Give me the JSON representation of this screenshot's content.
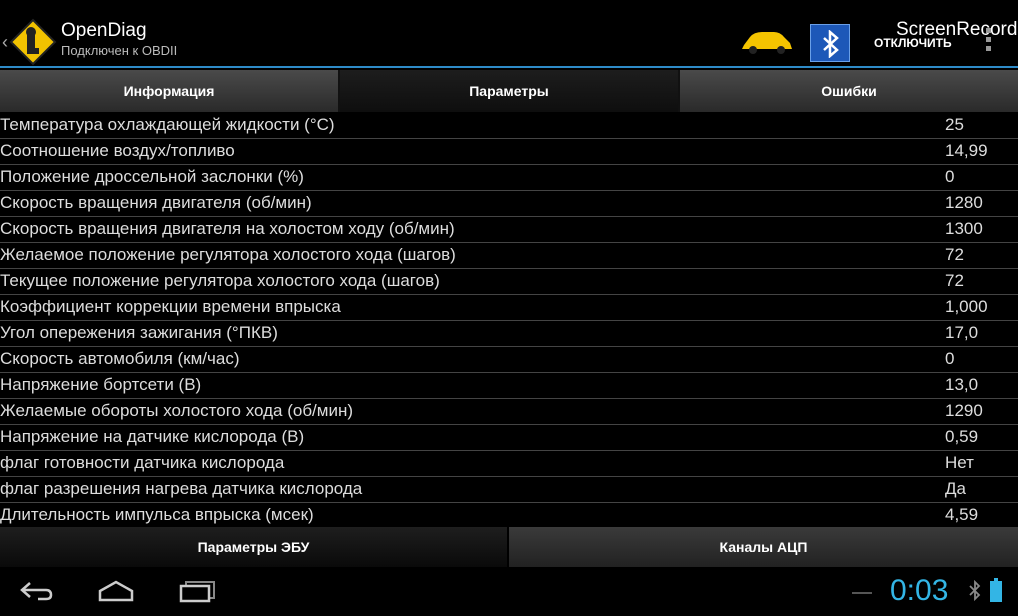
{
  "app": {
    "title": "OpenDiag",
    "subtitle": "Подключен к OBDII",
    "recorder_title": "ScreenRecorder",
    "disconnect_label": "ОТКЛЮЧИТЬ"
  },
  "tabs": [
    {
      "label": "Информация",
      "active": false
    },
    {
      "label": "Параметры",
      "active": true
    },
    {
      "label": "Ошибки",
      "active": false
    }
  ],
  "parameters": [
    {
      "name": "Температура охлаждающей жидкости (°С)",
      "value": "25"
    },
    {
      "name": "Соотношение воздух/топливо",
      "value": "14,99"
    },
    {
      "name": "Положение дроссельной заслонки (%)",
      "value": "0"
    },
    {
      "name": "Скорость вращения двигателя (об/мин)",
      "value": "1280"
    },
    {
      "name": "Скорость вращения двигателя на холостом ходу (об/мин)",
      "value": "1300"
    },
    {
      "name": "Желаемое положение регулятора холостого хода (шагов)",
      "value": "72"
    },
    {
      "name": "Текущее положение регулятора холостого хода (шагов)",
      "value": "72"
    },
    {
      "name": "Коэффициент коррекции времени впрыска",
      "value": "1,000"
    },
    {
      "name": "Угол опережения зажигания (°ПКВ)",
      "value": "17,0"
    },
    {
      "name": "Скорость автомобиля (км/час)",
      "value": "0"
    },
    {
      "name": "Напряжение бортсети (В)",
      "value": "13,0"
    },
    {
      "name": "Желаемые обороты холостого хода (об/мин)",
      "value": "1290"
    },
    {
      "name": "Напряжение на датчике кислорода (В)",
      "value": "0,59"
    },
    {
      "name": "флаг готовности датчика кислорода",
      "value": "Нет"
    },
    {
      "name": "флаг разрешения нагрева датчика кислорода",
      "value": "Да"
    },
    {
      "name": "Длительность импульса впрыска (мсек)",
      "value": "4,59"
    }
  ],
  "bottom_tabs": [
    {
      "label": "Параметры ЭБУ"
    },
    {
      "label": "Каналы АЦП"
    }
  ],
  "status": {
    "clock": "0:03"
  },
  "icons": {
    "app": "opendiag-road-sign-icon",
    "car": "car-icon",
    "bluetooth_toggle": "bluetooth-icon",
    "overflow": "overflow-menu-icon",
    "back": "back-icon",
    "home": "home-icon",
    "recents": "recent-apps-icon",
    "bt_status": "bluetooth-status-icon",
    "battery": "battery-icon"
  },
  "colors": {
    "accent": "#33b5e5",
    "car": "#f5c400",
    "bluetooth_box": "#1d58b8"
  }
}
